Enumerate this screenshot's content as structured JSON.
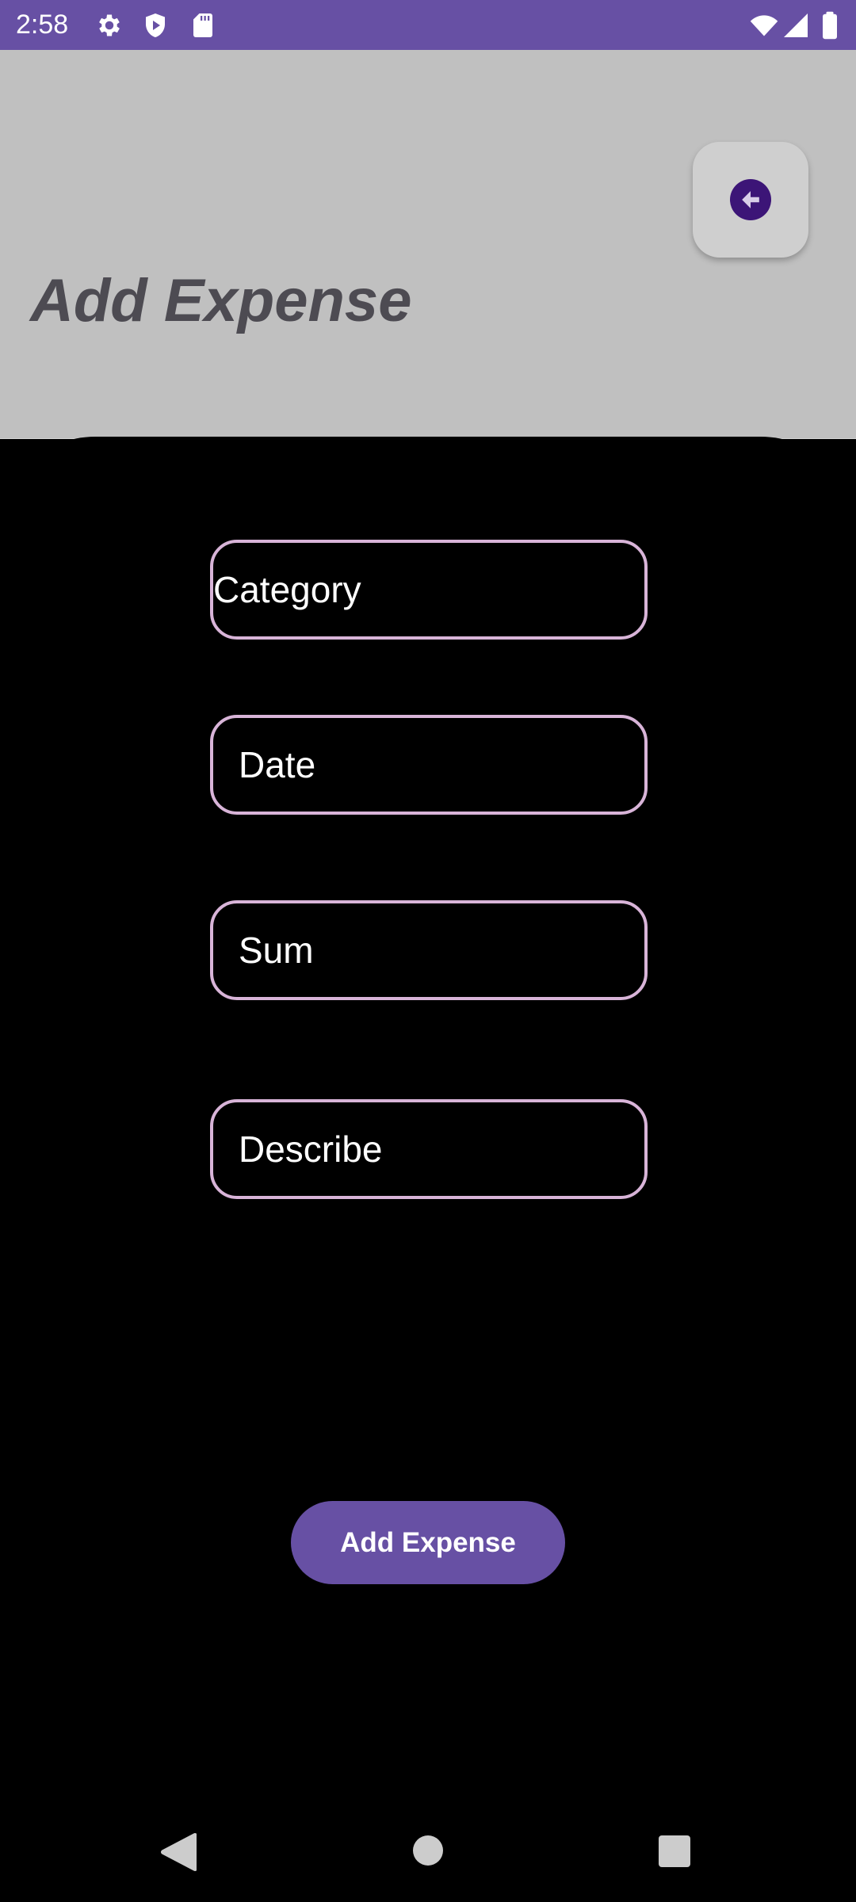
{
  "status_bar": {
    "time": "2:58",
    "left_icons": [
      "settings-icon",
      "shield-play-icon",
      "sd-card-icon"
    ],
    "right_icons": [
      "wifi-icon",
      "cellular-signal-icon",
      "battery-icon"
    ],
    "background": "#6750a4"
  },
  "header": {
    "title": "Add Expense",
    "back_icon": "arrow-left-icon",
    "background": "#c0c0c0"
  },
  "form": {
    "fields": [
      {
        "name": "category",
        "placeholder": "Category",
        "value": ""
      },
      {
        "name": "date",
        "placeholder": "Date",
        "value": ""
      },
      {
        "name": "sum",
        "placeholder": "Sum",
        "value": ""
      },
      {
        "name": "describe",
        "placeholder": "Describe",
        "value": ""
      }
    ],
    "submit_label": "Add Expense",
    "accent": "#6750a4",
    "field_border": "#d8b4d8"
  },
  "nav_bar": {
    "buttons": [
      "back-triangle-icon",
      "home-circle-icon",
      "recents-square-icon"
    ]
  }
}
